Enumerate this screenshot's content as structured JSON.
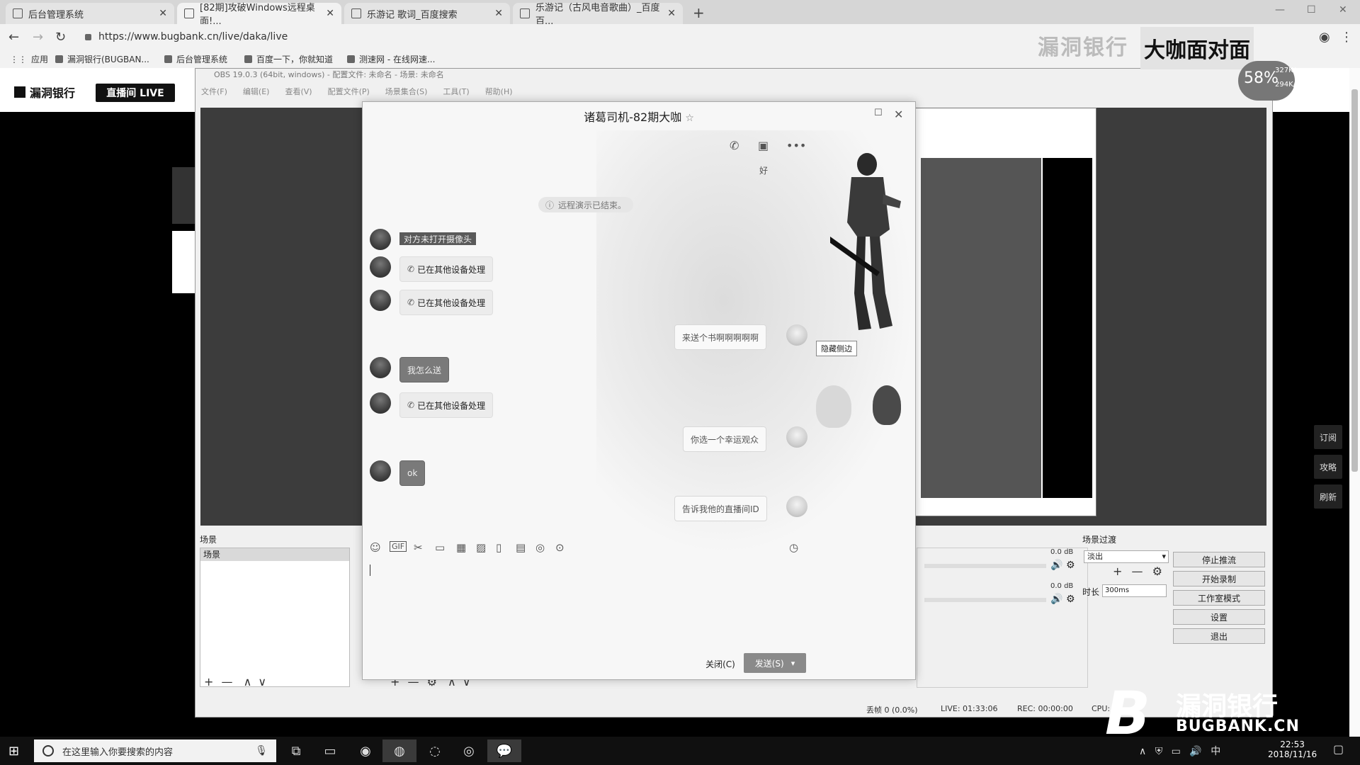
{
  "browser": {
    "tabs": [
      {
        "title": "后台管理系统"
      },
      {
        "title": "[82期]攻破Windows远程桌面!..."
      },
      {
        "title": "乐游记 歌词_百度搜索"
      },
      {
        "title": "乐游记（古风电音歌曲）_百度百..."
      }
    ],
    "url": "https://www.bugbank.cn/live/daka/live",
    "bookmarks": [
      "应用",
      "漏洞银行(BUGBAN...",
      "后台管理系统",
      "百度一下，你就知道",
      "测速网 - 在线网速..."
    ]
  },
  "site": {
    "logo": "漏洞银行",
    "live_button": "直播间 LIVE",
    "right_rail": [
      "订阅",
      "攻略",
      "刷新"
    ]
  },
  "obs": {
    "title": "OBS 19.0.3 (64bit, windows) - 配置文件: 未命名 - 场景: 未命名",
    "menu": [
      "文件(F)",
      "编辑(E)",
      "查看(V)",
      "配置文件(P)",
      "场景集合(S)",
      "工具(T)",
      "帮助(H)"
    ],
    "scenes_title": "场景",
    "scene_item": "场景",
    "transition_title": "场景过渡",
    "transition_value": "淡出",
    "duration_label": "时长",
    "duration_value": "300ms",
    "audio_db_1": "0.0 dB",
    "audio_db_2": "0.0 dB",
    "buttons": [
      "停止推流",
      "开始录制",
      "工作室模式",
      "设置",
      "退出"
    ],
    "status": {
      "dropped": "丢帧 0 (0.0%)",
      "live": "LIVE: 01:33:06",
      "rec": "REC: 00:00:00",
      "cpu": "CPU:"
    }
  },
  "chat": {
    "title": "诸葛司机-82期大咖",
    "header_hint": "好",
    "system_message": "远程演示已结束。",
    "messages": [
      {
        "side": "left",
        "text": "对方未打开摄像头"
      },
      {
        "side": "left",
        "text": "已在其他设备处理",
        "call": true
      },
      {
        "side": "left",
        "text": "已在其他设备处理",
        "call": true
      },
      {
        "side": "right",
        "text": "来送个书啊啊啊啊啊"
      },
      {
        "side": "left",
        "text": "我怎么送"
      },
      {
        "side": "left",
        "text": "已在其他设备处理",
        "call": true
      },
      {
        "side": "right",
        "text": "你选一个幸运观众"
      },
      {
        "side": "left",
        "text": "ok"
      },
      {
        "side": "right",
        "text": "告诉我他的直播间ID"
      }
    ],
    "tooltip": "隐藏侧边",
    "close_button": "关闭(C)",
    "send_button": "发送(S)"
  },
  "watermark": {
    "top_text": "漏洞银行",
    "top_logo": "大咖面对面",
    "gauge_percent": "58%",
    "speed_up": "327K/s",
    "speed_down": "294K/s",
    "bottom_big": "漏洞银行",
    "bottom_small": "BUGBANK.CN"
  },
  "taskbar": {
    "search_placeholder": "在这里输入你要搜索的内容",
    "ime": "中",
    "time": "22:53",
    "date": "2018/11/16"
  }
}
